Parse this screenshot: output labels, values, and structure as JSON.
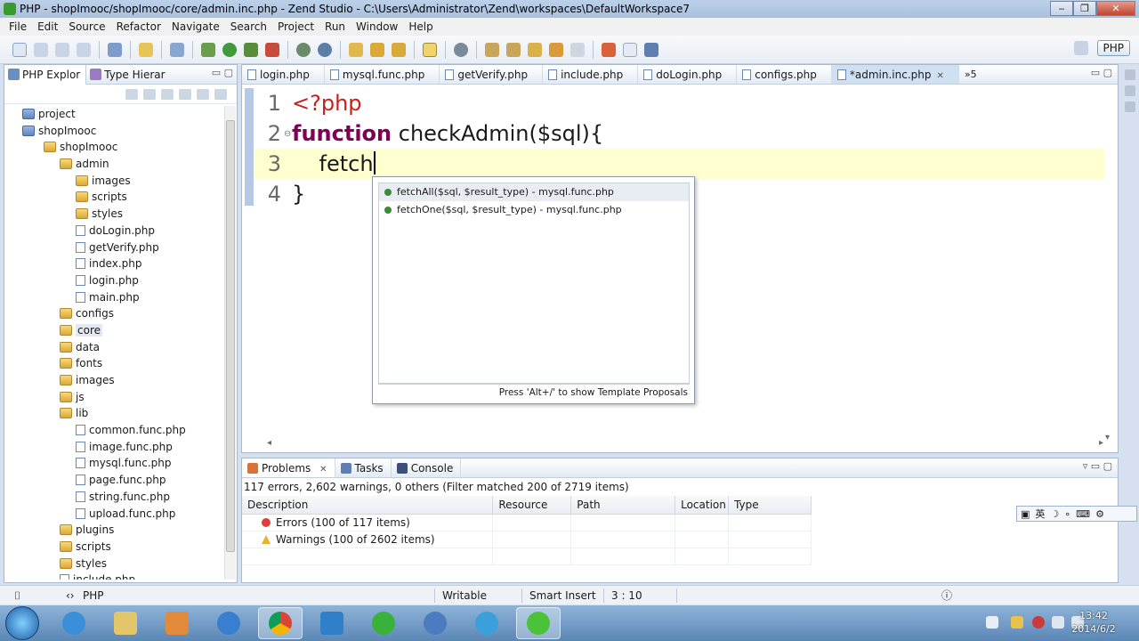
{
  "window": {
    "title": "PHP - shopImooc/shopImooc/core/admin.inc.php - Zend Studio - C:\\Users\\Administrator\\Zend\\workspaces\\DefaultWorkspace7",
    "controls": [
      "‒",
      "❐",
      "✕"
    ]
  },
  "menu": [
    "File",
    "Edit",
    "Source",
    "Refactor",
    "Navigate",
    "Search",
    "Project",
    "Run",
    "Window",
    "Help"
  ],
  "perspective": {
    "label": "PHP"
  },
  "explorer": {
    "tabs": [
      {
        "label": "PHP Explor"
      },
      {
        "label": "Type Hierar"
      }
    ],
    "tree": [
      {
        "label": "project",
        "type": "project",
        "depth": 0
      },
      {
        "label": "shopImooc",
        "type": "project",
        "depth": 0
      },
      {
        "label": "shopImooc",
        "type": "folder",
        "depth": 1
      },
      {
        "label": "admin",
        "type": "folder",
        "depth": 2
      },
      {
        "label": "images",
        "type": "folder",
        "depth": 3
      },
      {
        "label": "scripts",
        "type": "folder",
        "depth": 3
      },
      {
        "label": "styles",
        "type": "folder",
        "depth": 3
      },
      {
        "label": "doLogin.php",
        "type": "file",
        "depth": 3
      },
      {
        "label": "getVerify.php",
        "type": "file",
        "depth": 3
      },
      {
        "label": "index.php",
        "type": "file",
        "depth": 3
      },
      {
        "label": "login.php",
        "type": "file",
        "depth": 3
      },
      {
        "label": "main.php",
        "type": "file",
        "depth": 3
      },
      {
        "label": "configs",
        "type": "folder",
        "depth": 2
      },
      {
        "label": "core",
        "type": "folder",
        "depth": 2,
        "selected": true
      },
      {
        "label": "data",
        "type": "folder",
        "depth": 2
      },
      {
        "label": "fonts",
        "type": "folder",
        "depth": 2
      },
      {
        "label": "images",
        "type": "folder",
        "depth": 2
      },
      {
        "label": "js",
        "type": "folder",
        "depth": 2
      },
      {
        "label": "lib",
        "type": "folder",
        "depth": 2
      },
      {
        "label": "common.func.php",
        "type": "file",
        "depth": 3
      },
      {
        "label": "image.func.php",
        "type": "file",
        "depth": 3
      },
      {
        "label": "mysql.func.php",
        "type": "file",
        "depth": 3
      },
      {
        "label": "page.func.php",
        "type": "file",
        "depth": 3
      },
      {
        "label": "string.func.php",
        "type": "file",
        "depth": 3
      },
      {
        "label": "upload.func.php",
        "type": "file",
        "depth": 3
      },
      {
        "label": "plugins",
        "type": "folder",
        "depth": 2
      },
      {
        "label": "scripts",
        "type": "folder",
        "depth": 2
      },
      {
        "label": "styles",
        "type": "folder",
        "depth": 2
      },
      {
        "label": "include.php",
        "type": "file",
        "depth": 2
      }
    ]
  },
  "editor": {
    "tabs": [
      {
        "label": "login.php"
      },
      {
        "label": "mysql.func.php"
      },
      {
        "label": "getVerify.php"
      },
      {
        "label": "include.php"
      },
      {
        "label": "doLogin.php"
      },
      {
        "label": "configs.php"
      },
      {
        "label": "*admin.inc.php",
        "active": true
      }
    ],
    "overflow_label": "»5",
    "lines": [
      {
        "n": "1",
        "tokens": [
          {
            "t": "<?php",
            "c": "tag"
          }
        ]
      },
      {
        "n": "2",
        "tokens": [
          {
            "t": "function",
            "c": "kw"
          },
          {
            "t": " checkAdmin($sql){",
            "c": ""
          }
        ]
      },
      {
        "n": "3",
        "tokens": [
          {
            "t": "    fetch",
            "c": ""
          }
        ],
        "current": true
      },
      {
        "n": "4",
        "tokens": [
          {
            "t": "}",
            "c": ""
          }
        ]
      }
    ]
  },
  "autocomplete": {
    "items": [
      {
        "label": "fetchAll($sql, $result_type) - mysql.func.php",
        "selected": true
      },
      {
        "label": "fetchOne($sql, $result_type) - mysql.func.php"
      }
    ],
    "footer": "Press 'Alt+/' to show Template Proposals"
  },
  "problems": {
    "tabs": [
      {
        "label": "Problems",
        "close": "✕"
      },
      {
        "label": "Tasks"
      },
      {
        "label": "Console"
      }
    ],
    "summary": "117 errors, 2,602 warnings, 0 others (Filter matched 200 of 2719 items)",
    "columns": [
      "Description",
      "Resource",
      "Path",
      "Location",
      "Type"
    ],
    "rows": [
      {
        "kind": "error",
        "description": "Errors (100 of 117 items)"
      },
      {
        "kind": "warning",
        "description": "Warnings (100 of 2602 items)"
      }
    ]
  },
  "statusbar": {
    "breadcrumb": "PHP",
    "mode": "Writable",
    "insert": "Smart Insert",
    "position": "3 : 10"
  },
  "ime": {
    "label": "英"
  },
  "taskbar": {
    "time": "13:42",
    "date": "2014/6/2"
  }
}
